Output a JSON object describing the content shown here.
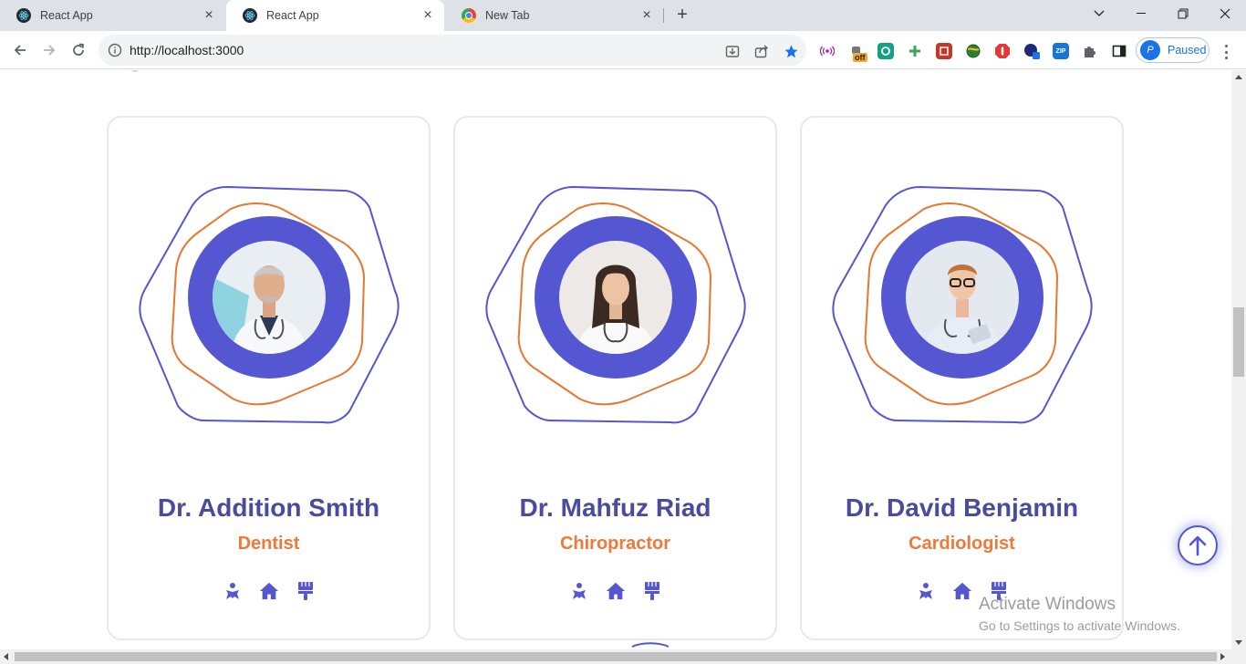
{
  "browser": {
    "tabs": [
      {
        "title": "React App",
        "active": false
      },
      {
        "title": "React App",
        "active": true
      },
      {
        "title": "New Tab",
        "active": false
      }
    ],
    "url": "http://localhost:3000",
    "profile_label": "Paused",
    "profile_initial": "P",
    "extension_badge": "off",
    "zip_badge": "ZIP"
  },
  "doctors": [
    {
      "name": "Dr. Addition Smith",
      "specialty": "Dentist"
    },
    {
      "name": "Dr. Mahfuz Riad",
      "specialty": "Chiropractor"
    },
    {
      "name": "Dr. David Benjamin",
      "specialty": "Cardiologist"
    }
  ],
  "watermark": {
    "title": "Activate Windows",
    "subtitle": "Go to Settings to activate Windows."
  },
  "colors": {
    "accent": "#5456d2",
    "orange": "#f07838",
    "name": "#4a4a9e"
  }
}
